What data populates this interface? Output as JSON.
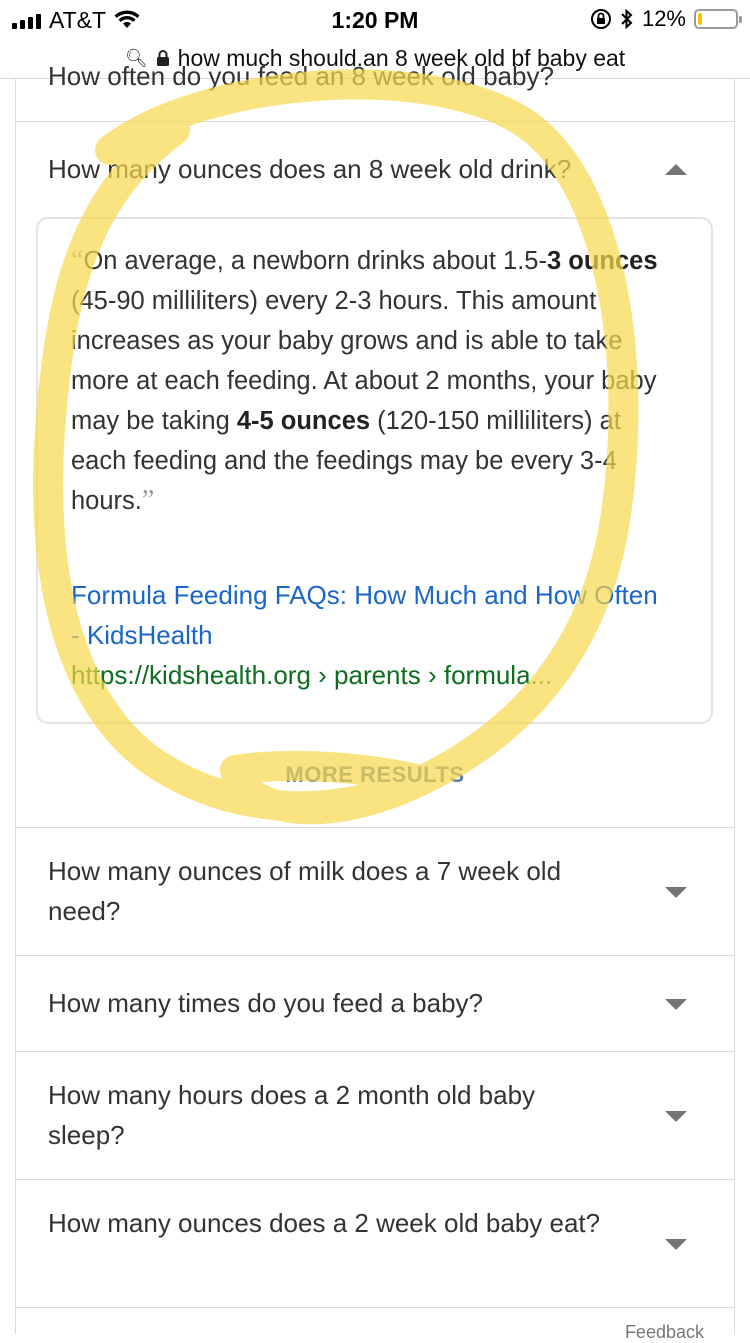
{
  "status_bar": {
    "carrier": "AT&T",
    "time": "1:20 PM",
    "battery": "12%",
    "battery_level": 0.12
  },
  "url_bar": {
    "url": "how much should.an 8 week old bf baby eat"
  },
  "previous_question": "How often do you feed an 8 week old baby?",
  "expanded": {
    "question": "How many ounces does an 8 week old drink?",
    "quote_parts": {
      "p1": "On average, a newborn drinks about 1.5-",
      "b1": "3 ounces",
      "p2": " (45-90 milliliters) every 2-3 hours. This amount increases as your baby grows and is able to take more at each feeding. At about 2 months, your baby may be taking ",
      "b2": "4-5 ounces",
      "p3": " (120-150 milliliters) at each feeding and the feedings may be every 3-4 hours."
    },
    "source_title": "Formula Feeding FAQs: How Much and How Often - KidsHealth",
    "source_url": "https://kidshealth.org › parents › formula..."
  },
  "more_results_label": "MORE RESULTS",
  "questions": [
    "How many ounces of milk does a 7 week old need?",
    "How many times do you feed a baby?",
    "How many hours does a 2 month old baby sleep?",
    "How many ounces does a 2 week old baby eat?"
  ],
  "feedback_label": "Feedback",
  "colors": {
    "link": "#1a66c9",
    "url_green": "#0d6e1f",
    "highlight": "#f7d94c",
    "more_results": "#5c7ea6"
  }
}
